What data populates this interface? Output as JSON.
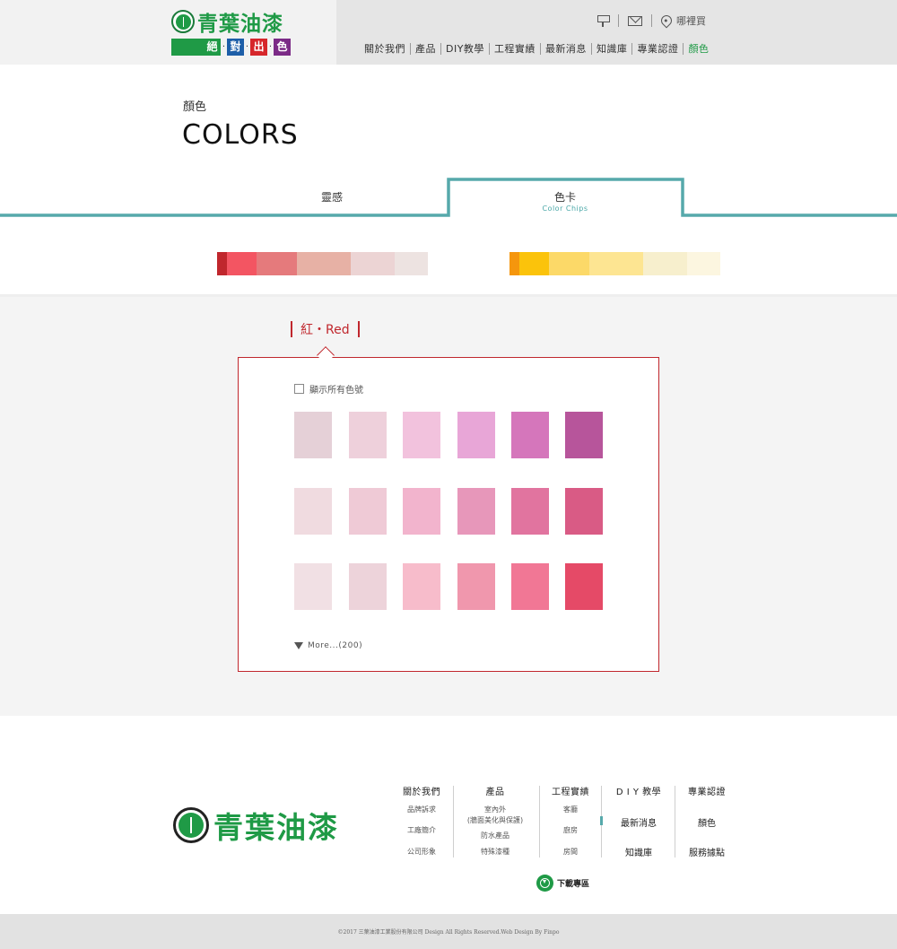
{
  "header": {
    "logo_name": "青葉油漆",
    "slogan": [
      "絕",
      "對",
      "出",
      "色"
    ],
    "where_label": "哪裡買",
    "nav": [
      "關於我們",
      "產品",
      "DIY教學",
      "工程實績",
      "最新消息",
      "知識庫",
      "專業認證",
      "顏色"
    ]
  },
  "page": {
    "subtitle": "顏色",
    "title": "COLORS"
  },
  "tabs": {
    "inspire": "靈感",
    "chips": "色卡",
    "chips_sub": "Color Chips"
  },
  "colors": {
    "accent_teal": "#56a9ab",
    "accent_red": "#c0272d",
    "brand_green": "#1f9a46",
    "red_bar": [
      "#c0272d",
      "#f35562",
      "#e57a7c",
      "#e7b1a5",
      "#ecd4d4",
      "#ede3e1"
    ],
    "yellow_bar": [
      "#f5960d",
      "#fbc30b",
      "#fcd968",
      "#fde592",
      "#f7efcd",
      "#fcf6e0"
    ]
  },
  "family": {
    "label": "紅・Red",
    "show_all": "顯示所有色號",
    "more": "More...(200)",
    "chips": [
      [
        "#e5d0d7",
        "#eed0db",
        "#f2c2dd",
        "#e8a6d7",
        "#d576bb",
        "#b7559b"
      ],
      [
        "#f0dbe0",
        "#efcad6",
        "#f2b4cd",
        "#e797ba",
        "#e1749f",
        "#d95b85"
      ],
      [
        "#f1e0e4",
        "#edd3da",
        "#f7bccb",
        "#f097ad",
        "#f17795",
        "#e54a67"
      ]
    ]
  },
  "footer": {
    "logo_name": "青葉油漆",
    "col_about": {
      "head": "關於我們",
      "items": [
        "品牌訴求",
        "工廠簡介",
        "公司形象"
      ]
    },
    "col_products": {
      "head": "產品",
      "items": [
        "室內外",
        "(牆面美化與保護)",
        "防水產品",
        "特殊漆種"
      ]
    },
    "col_projects": {
      "head": "工程實績",
      "items": [
        "客廳",
        "廚房",
        "房間"
      ]
    },
    "col_diy": {
      "head": "D I Y 教學",
      "items": [
        "最新消息",
        "知識庫"
      ]
    },
    "col_cert": {
      "head": "專業認證",
      "items": [
        "顏色",
        "服務據點"
      ]
    },
    "download": "下載專區",
    "copyright": "©2017 三葉油漆工業股份有限公司 Design All Rights Reserved.Web Design By Finpo"
  }
}
